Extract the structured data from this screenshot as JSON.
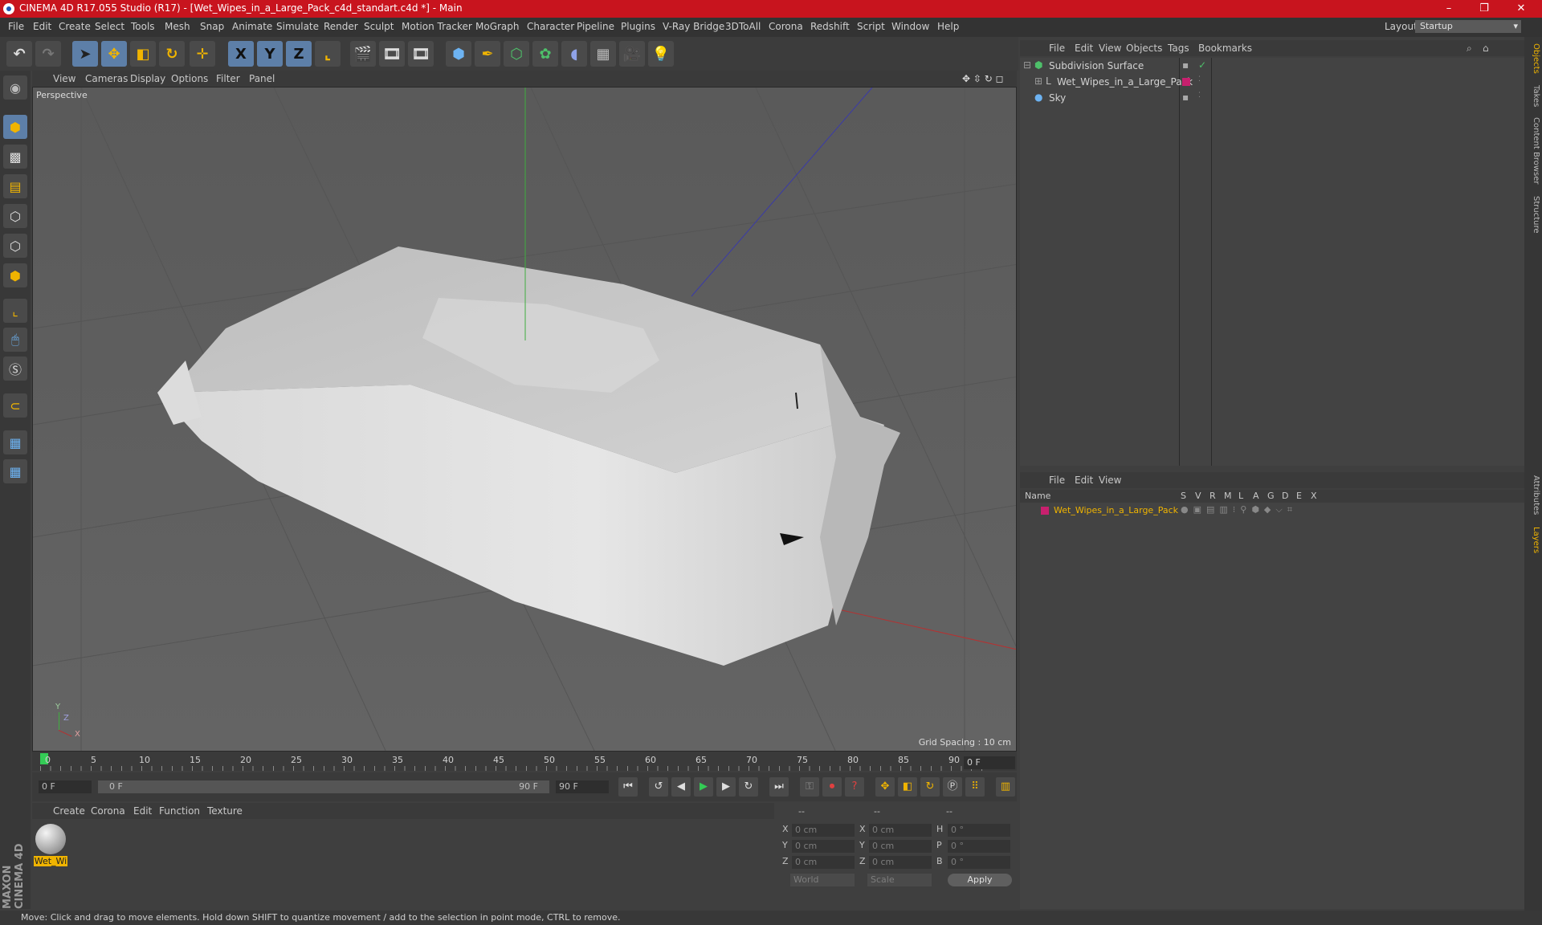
{
  "window": {
    "title": "CINEMA 4D R17.055 Studio (R17) - [Wet_Wipes_in_a_Large_Pack_c4d_standart.c4d *] - Main",
    "controls": [
      "–",
      "❐",
      "✕"
    ]
  },
  "menubar": {
    "items": [
      "File",
      "Edit",
      "Create",
      "Select",
      "Tools",
      "Mesh",
      "Snap",
      "Animate",
      "Simulate",
      "Render",
      "Sculpt",
      "Motion Tracker",
      "MoGraph",
      "Character",
      "Pipeline",
      "Plugins",
      "V-Ray Bridge",
      "3DToAll",
      "Corona",
      "Redshift",
      "Script",
      "Window",
      "Help"
    ],
    "layout_label": "Layout:",
    "layout_value": "Startup"
  },
  "toolbar": {
    "axis_x": "X",
    "axis_y": "Y",
    "axis_z": "Z"
  },
  "viewport": {
    "menu": [
      "View",
      "Cameras",
      "Display",
      "Options",
      "Filter",
      "Panel"
    ],
    "camera_label": "Perspective",
    "grid_spacing": "Grid Spacing : 10 cm",
    "axis_y": "Y",
    "axis_z": "Z",
    "axis_x": "X"
  },
  "timeline": {
    "ticks": [
      "0",
      "5",
      "10",
      "15",
      "20",
      "25",
      "30",
      "35",
      "40",
      "45",
      "50",
      "55",
      "60",
      "65",
      "70",
      "75",
      "80",
      "85",
      "90"
    ],
    "current_frame": "0 F",
    "start_field": "0 F",
    "range_start": "0 F",
    "range_end": "90 F",
    "end_field": "90 F"
  },
  "material_manager": {
    "menu": [
      "Create",
      "Corona",
      "Edit",
      "Function",
      "Texture"
    ],
    "material_name": "Wet_Wi"
  },
  "coordinates": {
    "header": [
      "--",
      "--",
      "--"
    ],
    "rows": [
      {
        "l1": "X",
        "v1": "0 cm",
        "l2": "X",
        "v2": "0 cm",
        "l3": "H",
        "v3": "0 °"
      },
      {
        "l1": "Y",
        "v1": "0 cm",
        "l2": "Y",
        "v2": "0 cm",
        "l3": "P",
        "v3": "0 °"
      },
      {
        "l1": "Z",
        "v1": "0 cm",
        "l2": "Z",
        "v2": "0 cm",
        "l3": "B",
        "v3": "0 °"
      }
    ],
    "mode1": "World",
    "mode2": "Scale",
    "apply": "Apply"
  },
  "object_manager": {
    "menu": [
      "File",
      "Edit",
      "View",
      "Objects",
      "Tags",
      "Bookmarks"
    ],
    "objects": [
      "Subdivision Surface",
      "Wet_Wipes_in_a_Large_Pack",
      "Sky"
    ]
  },
  "layer_manager": {
    "menu": [
      "File",
      "Edit",
      "View"
    ],
    "col_name": "Name",
    "cols": [
      "S",
      "V",
      "R",
      "M",
      "L",
      "A",
      "G",
      "D",
      "E",
      "X"
    ],
    "layers": [
      "Wet_Wipes_in_a_Large_Pack"
    ]
  },
  "side_tabs": [
    "Objects",
    "Takes",
    "Content Browser",
    "Structure",
    "Attributes",
    "Layers"
  ],
  "branding": "MAXON CINEMA 4D",
  "status_text": "Move: Click and drag to move elements. Hold down SHIFT to quantize movement / add to the selection in point mode, CTRL to remove.",
  "colors": {
    "titlebar": "#c8141e",
    "selection": "#5d7fa8",
    "layer_color": "#c8206e",
    "highlight": "#f0b400"
  }
}
